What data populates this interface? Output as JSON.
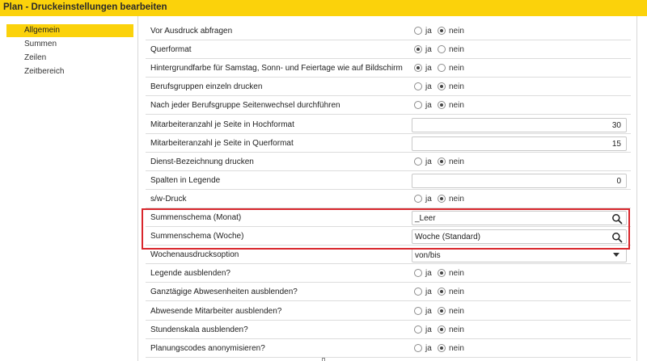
{
  "window": {
    "title": "Plan - Druckeinstellungen bearbeiten"
  },
  "sidebar": {
    "items": [
      {
        "label": "Allgemein",
        "active": true
      },
      {
        "label": "Summen",
        "active": false
      },
      {
        "label": "Zeilen",
        "active": false
      },
      {
        "label": "Zeitbereich",
        "active": false
      }
    ]
  },
  "radio_labels": {
    "yes": "ja",
    "no": "nein"
  },
  "settings": [
    {
      "label": "Vor Ausdruck abfragen",
      "type": "radio",
      "value": "nein"
    },
    {
      "label": "Querformat",
      "type": "radio",
      "value": "ja"
    },
    {
      "label": "Hintergrundfarbe für Samstag, Sonn- und Feiertage wie auf Bildschirm",
      "type": "radio",
      "value": "ja"
    },
    {
      "label": "Berufsgruppen einzeln drucken",
      "type": "radio",
      "value": "nein"
    },
    {
      "label": "Nach jeder Berufsgruppe Seitenwechsel durchführen",
      "type": "radio",
      "value": "nein"
    },
    {
      "label": "Mitarbeiteranzahl je Seite in Hochformat",
      "type": "number",
      "value": "30"
    },
    {
      "label": "Mitarbeiteranzahl je Seite in Querformat",
      "type": "number",
      "value": "15"
    },
    {
      "label": "Dienst-Bezeichnung drucken",
      "type": "radio",
      "value": "nein"
    },
    {
      "label": "Spalten in Legende",
      "type": "number",
      "value": "0"
    },
    {
      "label": "s/w-Druck",
      "type": "radio",
      "value": "nein"
    },
    {
      "label": "Summenschema (Monat)",
      "type": "lookup",
      "value": "_Leer"
    },
    {
      "label": "Summenschema (Woche)",
      "type": "lookup",
      "value": "Woche (Standard)"
    },
    {
      "label": "Wochenausdrucksoption",
      "type": "select",
      "value": "von/bis"
    },
    {
      "label": "Legende ausblenden?",
      "type": "radio",
      "value": "nein"
    },
    {
      "label": "Ganztägige Abwesenheiten ausblenden?",
      "type": "radio",
      "value": "nein"
    },
    {
      "label": "Abwesende Mitarbeiter ausblenden?",
      "type": "radio",
      "value": "nein"
    },
    {
      "label": "Stundenskala ausblenden?",
      "type": "radio",
      "value": "nein"
    },
    {
      "label": "Planungscodes anonymisieren?",
      "type": "radio",
      "value": "nein"
    }
  ],
  "colors": {
    "accent": "#fbd20b",
    "highlight_border": "#d9262c"
  }
}
